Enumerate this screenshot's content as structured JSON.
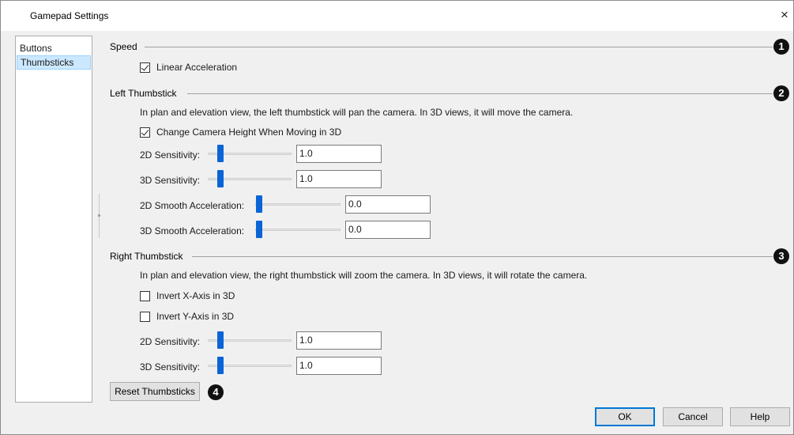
{
  "window": {
    "title": "Gamepad Settings",
    "close_glyph": "×"
  },
  "nav": {
    "items": [
      {
        "label": "Buttons"
      },
      {
        "label": "Thumbsticks"
      }
    ]
  },
  "speed": {
    "title": "Speed",
    "marker": "1",
    "linear_acceleration": {
      "label": "Linear Acceleration",
      "checked": true
    }
  },
  "left_thumbstick": {
    "title": "Left Thumbstick",
    "marker": "2",
    "description": "In plan and elevation view, the left thumbstick will pan the camera. In 3D views, it will move the camera.",
    "change_camera_height": {
      "label": "Change Camera Height When Moving in 3D",
      "checked": true
    },
    "sensitivity_2d": {
      "label": "2D Sensitivity:",
      "value": "1.0"
    },
    "sensitivity_3d": {
      "label": "3D Sensitivity:",
      "value": "1.0"
    },
    "smooth_accel_2d": {
      "label": "2D Smooth Acceleration:",
      "value": "0.0"
    },
    "smooth_accel_3d": {
      "label": "3D Smooth Acceleration:",
      "value": "0.0"
    }
  },
  "right_thumbstick": {
    "title": "Right Thumbstick",
    "marker": "3",
    "description": "In plan and elevation view, the right thumbstick will zoom the camera. In 3D views, it will rotate the camera.",
    "invert_x": {
      "label": "Invert X-Axis in 3D",
      "checked": false
    },
    "invert_y": {
      "label": "Invert Y-Axis in 3D",
      "checked": false
    },
    "sensitivity_2d": {
      "label": "2D Sensitivity:",
      "value": "1.0"
    },
    "sensitivity_3d": {
      "label": "3D Sensitivity:",
      "value": "1.0"
    }
  },
  "reset": {
    "label": "Reset Thumbsticks",
    "marker": "4"
  },
  "footer": {
    "ok_label": "OK",
    "cancel_label": "Cancel",
    "help_label": "Help"
  },
  "colors": {
    "accent": "#0a64d6",
    "selection": "#cce8ff",
    "marker": "#111111"
  }
}
